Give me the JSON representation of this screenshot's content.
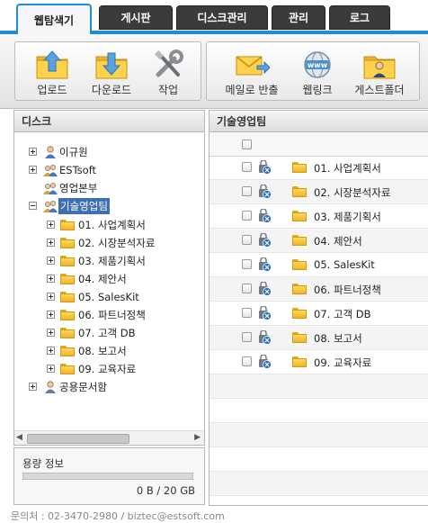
{
  "tabs": [
    {
      "label": "웹탐색기",
      "active": true
    },
    {
      "label": "게시판",
      "active": false
    },
    {
      "label": "디스크관리",
      "active": false
    },
    {
      "label": "관리",
      "active": false
    },
    {
      "label": "로그",
      "active": false
    }
  ],
  "toolbar": {
    "upload": "업로드",
    "download": "다운로드",
    "work": "작업",
    "mail_export": "메일로 반출",
    "weblink": "웹링크",
    "guest_folder": "게스트폴더",
    "weblink_badge": "www"
  },
  "disk_panel": {
    "title": "디스크",
    "tree": {
      "users": [
        "이규원",
        "ESTsoft",
        "영업본부",
        "기술영업팀"
      ],
      "selected": "기술영업팀",
      "folders": [
        "01. 사업계획서",
        "02. 시장분석자료",
        "03. 제품기획서",
        "04. 제안서",
        "05. SalesKit",
        "06. 파트너정책",
        "07. 고객 DB",
        "08. 보고서",
        "09. 교육자료"
      ],
      "shared": "공용문서함"
    }
  },
  "capacity": {
    "title": "용량 정보",
    "value": "0 B / 20 GB",
    "used_fraction": 0.0
  },
  "file_panel": {
    "title": "기술영업팀",
    "files": [
      "01. 사업계획서",
      "02. 시장분석자료",
      "03. 제품기획서",
      "04. 제안서",
      "05. SalesKit",
      "06. 파트너정책",
      "07. 고객 DB",
      "08. 보고서",
      "09. 교육자료"
    ]
  },
  "footer": "문의처 : 02-3470-2980 / biztec@estsoft.com",
  "colors": {
    "accent": "#1c8ed6",
    "tab_dark": "#3b3b3b",
    "selected": "#3d6fb6",
    "folder": "#f5c542"
  }
}
